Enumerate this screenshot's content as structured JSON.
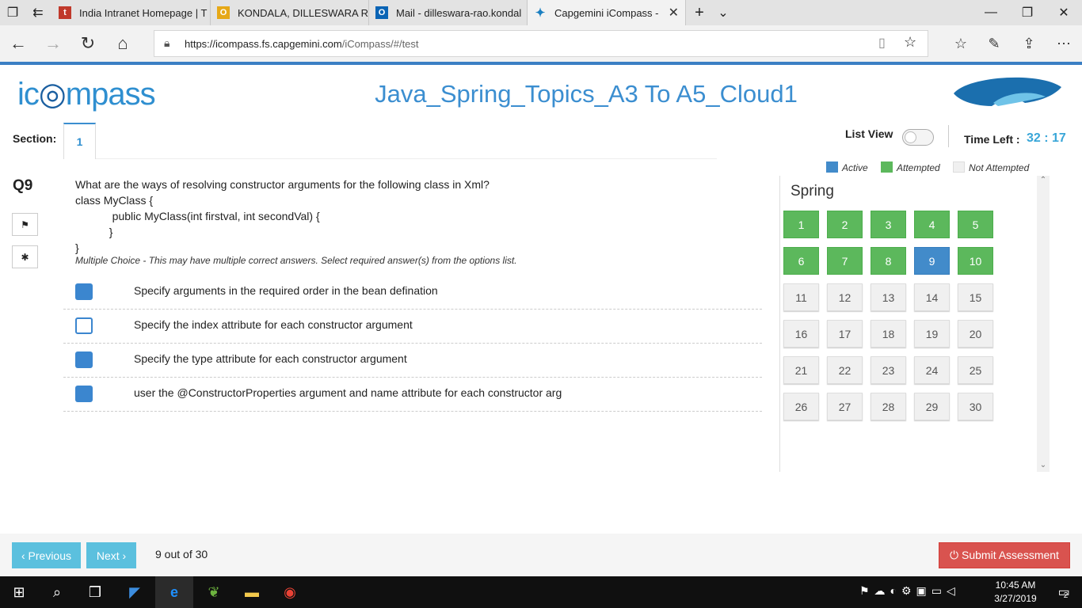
{
  "browser": {
    "tabs": [
      {
        "title": "India Intranet Homepage | T",
        "favicon": "t-icon"
      },
      {
        "title": "KONDALA, DILLESWARA RA",
        "favicon": "o-icon"
      },
      {
        "title": "Mail - dilleswara-rao.kondal",
        "favicon": "outlook-icon"
      },
      {
        "title": "Capgemini iCompass - ",
        "favicon": "capgemini-icon"
      }
    ],
    "new_tab": "+",
    "tab_menu": "⌄",
    "url_host": "https://icompass.fs.capgemini.com",
    "url_path": "/iCompass/#/test"
  },
  "page": {
    "logo_text_a": "ic",
    "logo_text_b": "mpass",
    "title": "Java_Spring_Topics_A3 To A5_Cloud1",
    "section_label": "Section:",
    "section_tab": "1",
    "list_view_label": "List View",
    "time_left_label": "Time Left :",
    "time_left_value": "32 : 17"
  },
  "question": {
    "number": "Q9",
    "lines": [
      "What are the ways of resolving constructor arguments for the following class in Xml?",
      "class MyClass {",
      "            public MyClass(int firstval, int secondVal) {",
      "           }",
      "}"
    ],
    "hint": "Multiple Choice - This may have multiple correct answers. Select required answer(s) from the options list.",
    "options": [
      {
        "text": "Specify arguments in the required order in the bean defination",
        "checked": true
      },
      {
        "text": "Specify the index attribute for each constructor argument",
        "checked": false
      },
      {
        "text": "Specify the type attribute for each constructor argument",
        "checked": true
      },
      {
        "text": "user the @ConstructorProperties argument and name attribute for each constructor arg",
        "checked": true
      }
    ]
  },
  "legend": {
    "active": "Active",
    "attempted": "Attempted",
    "not_attempted": "Not Attempted",
    "colors": {
      "active": "#428bca",
      "attempted": "#5cb85c",
      "not_attempted": "#f0f0f0"
    }
  },
  "palette": {
    "section_name": "Spring",
    "questions": [
      {
        "n": "1",
        "state": "attempted"
      },
      {
        "n": "2",
        "state": "attempted"
      },
      {
        "n": "3",
        "state": "attempted"
      },
      {
        "n": "4",
        "state": "attempted"
      },
      {
        "n": "5",
        "state": "attempted"
      },
      {
        "n": "6",
        "state": "attempted"
      },
      {
        "n": "7",
        "state": "attempted"
      },
      {
        "n": "8",
        "state": "attempted"
      },
      {
        "n": "9",
        "state": "active"
      },
      {
        "n": "10",
        "state": "attempted"
      },
      {
        "n": "11",
        "state": "notattempted"
      },
      {
        "n": "12",
        "state": "notattempted"
      },
      {
        "n": "13",
        "state": "notattempted"
      },
      {
        "n": "14",
        "state": "notattempted"
      },
      {
        "n": "15",
        "state": "notattempted"
      },
      {
        "n": "16",
        "state": "notattempted"
      },
      {
        "n": "17",
        "state": "notattempted"
      },
      {
        "n": "18",
        "state": "notattempted"
      },
      {
        "n": "19",
        "state": "notattempted"
      },
      {
        "n": "20",
        "state": "notattempted"
      },
      {
        "n": "21",
        "state": "notattempted"
      },
      {
        "n": "22",
        "state": "notattempted"
      },
      {
        "n": "23",
        "state": "notattempted"
      },
      {
        "n": "24",
        "state": "notattempted"
      },
      {
        "n": "25",
        "state": "notattempted"
      },
      {
        "n": "26",
        "state": "notattempted"
      },
      {
        "n": "27",
        "state": "notattempted"
      },
      {
        "n": "28",
        "state": "notattempted"
      },
      {
        "n": "29",
        "state": "notattempted"
      },
      {
        "n": "30",
        "state": "notattempted"
      }
    ]
  },
  "footer": {
    "previous_label": "‹ Previous",
    "next_label": "Next ›",
    "progress": "9 out of 30",
    "submit_label": "⏻ Submit Assessment"
  },
  "taskbar": {
    "time": "10:45 AM",
    "date": "3/27/2019",
    "notification_count": "2"
  }
}
